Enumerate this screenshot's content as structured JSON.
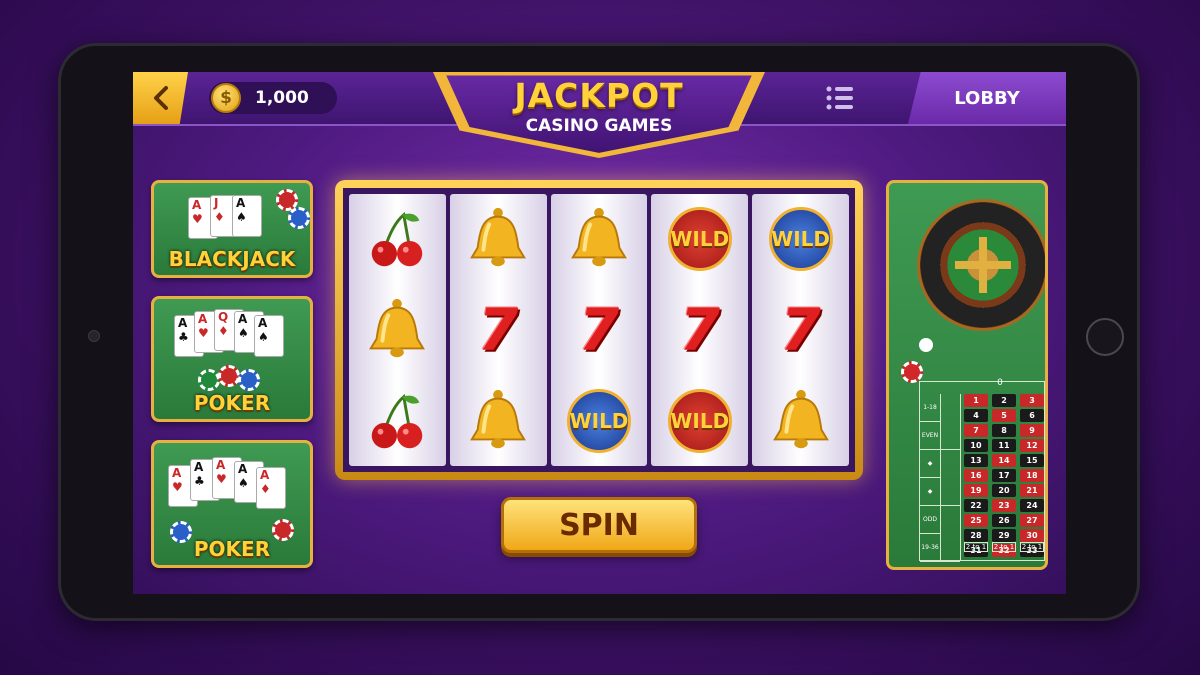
{
  "header": {
    "coin_symbol": "$",
    "coin_balance": "1,000",
    "title": "JACKPOT",
    "subtitle": "CASINO GAMES",
    "lobby_label": "LOBBY"
  },
  "games": [
    {
      "label": "BLACKJACK"
    },
    {
      "label": "POKER"
    },
    {
      "label": "POKER"
    }
  ],
  "reels": [
    [
      "cherry",
      "bell",
      "cherry"
    ],
    [
      "bell",
      "seven",
      "bell"
    ],
    [
      "bell",
      "seven",
      "wild-blue"
    ],
    [
      "wild-red",
      "seven",
      "wild-red"
    ],
    [
      "wild-blue",
      "seven",
      "bell"
    ]
  ],
  "symbols": {
    "seven": "7",
    "wild": "WILD"
  },
  "spin_label": "SPIN",
  "roulette": {
    "zero": "0",
    "numbers": [
      [
        "1",
        "2",
        "3"
      ],
      [
        "4",
        "5",
        "6"
      ],
      [
        "7",
        "8",
        "9"
      ],
      [
        "10",
        "11",
        "12"
      ],
      [
        "13",
        "14",
        "15"
      ],
      [
        "16",
        "17",
        "18"
      ],
      [
        "19",
        "20",
        "21"
      ],
      [
        "22",
        "23",
        "24"
      ],
      [
        "25",
        "26",
        "27"
      ],
      [
        "28",
        "29",
        "30"
      ],
      [
        "31",
        "32",
        "33"
      ]
    ],
    "red_numbers": [
      "1",
      "3",
      "5",
      "7",
      "9",
      "12",
      "14",
      "16",
      "18",
      "19",
      "21",
      "23",
      "25",
      "27",
      "30",
      "32"
    ],
    "side_bets": [
      "1-18",
      "EVEN",
      "◆",
      "◆",
      "ODD",
      "19-36"
    ],
    "dozens": [
      "2 to 1",
      "2 to 1",
      "2 to 1"
    ]
  },
  "colors": {
    "accent_gold": "#ffd23a",
    "felt_green": "#2a7a3a",
    "purple": "#4e1a80"
  }
}
